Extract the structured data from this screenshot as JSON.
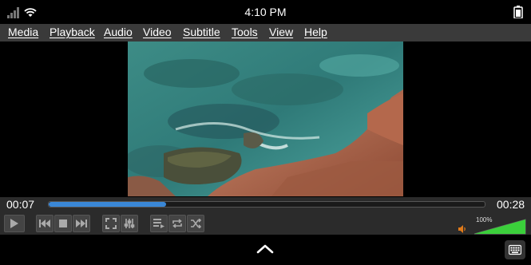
{
  "status": {
    "time": "4:10 PM",
    "icons": [
      "signal-icon",
      "wifi-icon",
      "battery-icon"
    ]
  },
  "menu": {
    "items": [
      "Media",
      "Playback",
      "Audio",
      "Video",
      "Subtitle",
      "Tools",
      "View",
      "Help"
    ]
  },
  "player": {
    "elapsed": "00:07",
    "total": "00:28",
    "progress_fraction": 0.27,
    "volume_label": "100%",
    "volume_fraction": 1.0,
    "accent_color": "#3a87d6",
    "volume_color": "#3bcf3b"
  },
  "controls": {
    "icons": [
      "play-icon",
      "previous-icon",
      "stop-icon",
      "next-icon",
      "fullscreen-icon",
      "extended-settings-icon",
      "playlist-icon",
      "loop-icon",
      "shuffle-icon",
      "speaker-icon"
    ]
  }
}
